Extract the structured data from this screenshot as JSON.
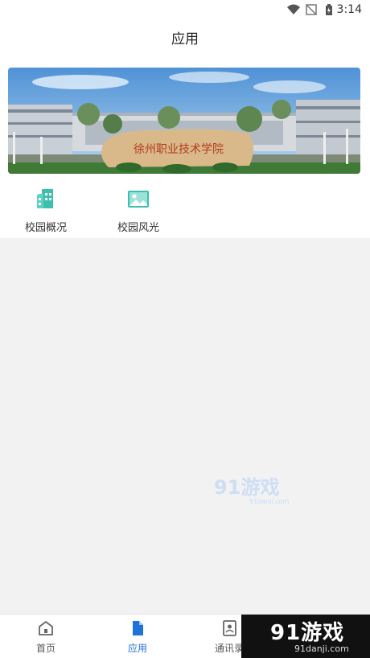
{
  "status_bar": {
    "time": "3:14"
  },
  "header": {
    "title": "应用"
  },
  "apps": [
    {
      "label": "校园概况",
      "icon": "building-icon"
    },
    {
      "label": "校园风光",
      "icon": "image-icon"
    }
  ],
  "banner": {
    "sign_text": "徐州职业技术学院"
  },
  "watermark": {
    "logo": "91游戏",
    "url": "91danji.com"
  },
  "bottom_nav": [
    {
      "label": "首页",
      "icon": "home-icon",
      "active": false
    },
    {
      "label": "应用",
      "icon": "document-icon",
      "active": true
    },
    {
      "label": "通讯录",
      "icon": "contacts-icon",
      "active": false
    }
  ],
  "colors": {
    "accent": "#1f73d8",
    "app_icon": "#3bbfae"
  }
}
